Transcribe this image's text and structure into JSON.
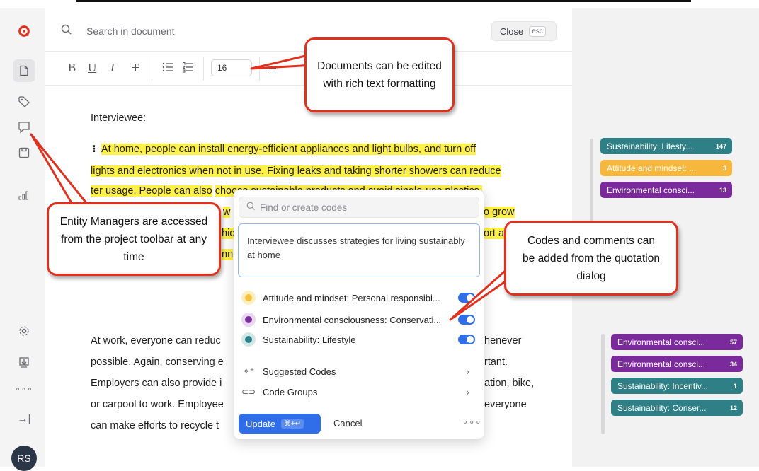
{
  "header": {
    "search_placeholder": "Search in document",
    "close_label": "Close",
    "close_shortcut": "esc"
  },
  "toolbar": {
    "bold": "B",
    "underline": "U",
    "italic": "I",
    "strikethrough": "T",
    "font_size": "16"
  },
  "sidebar": {
    "avatar_initials": "RS",
    "icons": [
      "logo-icon",
      "document-icon",
      "tag-icon",
      "comment-icon",
      "save-icon",
      "chart-icon",
      "settings-icon",
      "import-icon",
      "more-icon",
      "collapse-icon"
    ]
  },
  "document": {
    "label": "Interviewee:",
    "para1": [
      "At home, people can install energy-efficient appliances and light bulbs, and turn off",
      "lights and electronics when not in use. Fixing leaks and taking shorter showers can reduce",
      "ter usage. People can also",
      "choose sustainable products and avoid single-use plastics.",
      "w",
      "o grow",
      "hic",
      "ort a",
      "nn"
    ],
    "para2": [
      "At work, everyone can reduc",
      "henever",
      "possible. Again, conserving e",
      "rtant.",
      "Employers can also provide i",
      "ation, bike,",
      "or carpool to work. Employee",
      "everyone",
      "can make efforts to recycle t"
    ]
  },
  "dialog": {
    "search_placeholder": "Find or create codes",
    "comment": "Interviewee discusses strategies for living sustainably at home",
    "codes": [
      {
        "label": "Attitude and mindset: Personal responsibi...",
        "color": "#f6c23e",
        "enabled": true
      },
      {
        "label": "Environmental consciousness: Conservati...",
        "color": "#7b2d9e",
        "enabled": true
      },
      {
        "label": "Sustainability: Lifestyle",
        "color": "#2a8088",
        "enabled": true
      }
    ],
    "suggested_label": "Suggested Codes",
    "groups_label": "Code Groups",
    "update_label": "Update",
    "update_shortcut": "⌘+↵",
    "cancel_label": "Cancel",
    "more_label": "∘∘∘"
  },
  "right_codes_top": [
    {
      "label": "Sustainability: Lifesty...",
      "count": "147",
      "color": "#2f7f86"
    },
    {
      "label": "Attitude and mindset: ...",
      "count": "3",
      "color": "#f6b73c"
    },
    {
      "label": "Environmental consci...",
      "count": "13",
      "color": "#7b2a9c"
    }
  ],
  "right_codes_bottom": [
    {
      "label": "Environmental consci...",
      "count": "57",
      "color": "#7b2a9c"
    },
    {
      "label": "Environmental consci...",
      "count": "34",
      "color": "#7b2a9c"
    },
    {
      "label": "Sustainability: Incentiv...",
      "count": "1",
      "color": "#2f7f86"
    },
    {
      "label": "Sustainability: Conser...",
      "count": "12",
      "color": "#2f7f86"
    }
  ],
  "callouts": {
    "rich_text": "Documents can be edited with rich text formatting",
    "entity": "Entity Managers are accessed from the project toolbar at any time",
    "codes": "Codes and comments can be added from the quotation dialog"
  }
}
